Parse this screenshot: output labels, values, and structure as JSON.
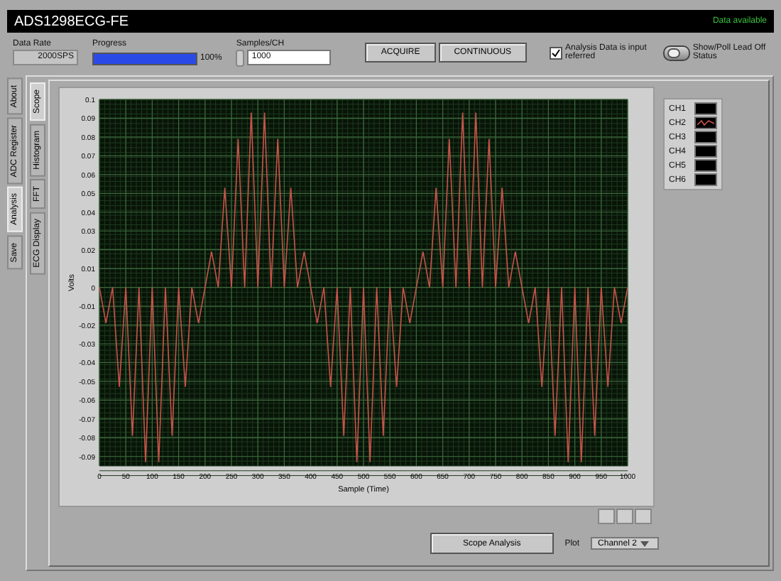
{
  "header": {
    "title": "ADS1298ECG-FE",
    "status": "Data available"
  },
  "controls": {
    "data_rate": {
      "label": "Data Rate",
      "value": "2000SPS"
    },
    "progress": {
      "label": "Progress",
      "level": 1,
      "reading": "100%"
    },
    "samples": {
      "label": "Samples/CH",
      "value": "1000"
    },
    "buttons": [
      "ACQUIRE",
      "CONTINUOUS"
    ],
    "input_referred": {
      "label": "Analysis Data is input referred",
      "checked": true
    },
    "lead_off": {
      "label": "Show/Poll Lead Off Status",
      "on": false
    }
  },
  "outer_tabs": [
    {
      "label": "About",
      "selected": false
    },
    {
      "label": "ADC Register",
      "selected": false
    },
    {
      "label": "Analysis",
      "selected": true
    },
    {
      "label": "Save",
      "selected": false
    }
  ],
  "inner_tabs": [
    {
      "label": "Scope",
      "selected": true
    },
    {
      "label": "Histogram",
      "selected": false
    },
    {
      "label": "FFT",
      "selected": false
    },
    {
      "label": "ECG Display",
      "selected": false
    }
  ],
  "scope": {
    "chart_data": {
      "type": "line",
      "xlabel": "Sample (Time)",
      "ylabel": "Volts",
      "x": [
        0,
        12.5,
        25,
        37.5,
        50,
        62.5,
        75,
        87.5,
        100,
        112.5,
        125,
        137.5,
        150,
        162.5,
        175,
        187.5,
        200,
        212.5,
        225,
        237.5,
        250,
        262.5,
        275,
        287.5,
        300,
        312.5,
        325,
        337.5,
        350,
        362.5,
        375,
        387.5,
        400,
        412.5,
        425,
        437.5,
        450,
        462.5,
        475,
        487.5,
        500,
        512.5,
        525,
        537.5,
        550,
        562.5,
        575,
        587.5,
        600,
        612.5,
        625,
        637.5,
        650,
        662.5,
        675,
        687.5,
        700,
        712.5,
        725,
        737.5,
        750,
        762.5,
        775,
        787.5,
        800,
        812.5,
        825,
        837.5,
        850,
        862.5,
        875,
        887.5,
        900,
        912.5,
        925,
        937.5,
        950,
        962.5,
        975,
        987.5,
        1000
      ],
      "grid": true,
      "series": [
        {
          "color": "#c8544a",
          "values": [
            0,
            -0.019,
            0,
            -0.053,
            0,
            -0.079,
            0,
            -0.093,
            0,
            -0.093,
            0,
            -0.079,
            0,
            -0.053,
            0,
            -0.019,
            0,
            0.019,
            0,
            0.053,
            0,
            0.079,
            0,
            0.093,
            0,
            0.093,
            0,
            0.079,
            0,
            0.053,
            0,
            0.019,
            0,
            -0.019,
            0,
            -0.053,
            0,
            -0.079,
            0,
            -0.093,
            0,
            -0.093,
            0,
            -0.079,
            0,
            -0.053,
            0,
            -0.019,
            0,
            0.019,
            0,
            0.053,
            0,
            0.079,
            0,
            0.093,
            0,
            0.093,
            0,
            0.079,
            0,
            0.053,
            0,
            0.019,
            0,
            -0.019,
            0,
            -0.053,
            0,
            -0.079,
            0,
            -0.093,
            0,
            -0.093,
            0,
            -0.079,
            0,
            -0.053,
            0,
            -0.019,
            0
          ]
        }
      ],
      "xlim": [
        0,
        1000
      ],
      "ylim": [
        -0.095,
        0.1
      ],
      "xticks": [
        0,
        50,
        100,
        150,
        200,
        250,
        300,
        350,
        400,
        450,
        500,
        550,
        600,
        650,
        700,
        750,
        800,
        850,
        900,
        950,
        1000
      ],
      "yticks": [
        0.1,
        0.09,
        0.08,
        0.07,
        0.06,
        0.05,
        0.04,
        0.03,
        0.02,
        0.01,
        0,
        -0.01,
        -0.02,
        -0.03,
        -0.04,
        -0.05,
        -0.06,
        -0.07,
        -0.08,
        -0.09
      ]
    },
    "legend": [
      {
        "label": "CH1",
        "plotted": false
      },
      {
        "label": "CH2",
        "plotted": true
      },
      {
        "label": "CH3",
        "plotted": false
      },
      {
        "label": "CH4",
        "plotted": false
      },
      {
        "label": "CH5",
        "plotted": false
      },
      {
        "label": "CH6",
        "plotted": false
      }
    ],
    "analysis_button": "Scope Analysis",
    "plot_select": {
      "label": "Plot",
      "value": "Channel 2"
    }
  }
}
